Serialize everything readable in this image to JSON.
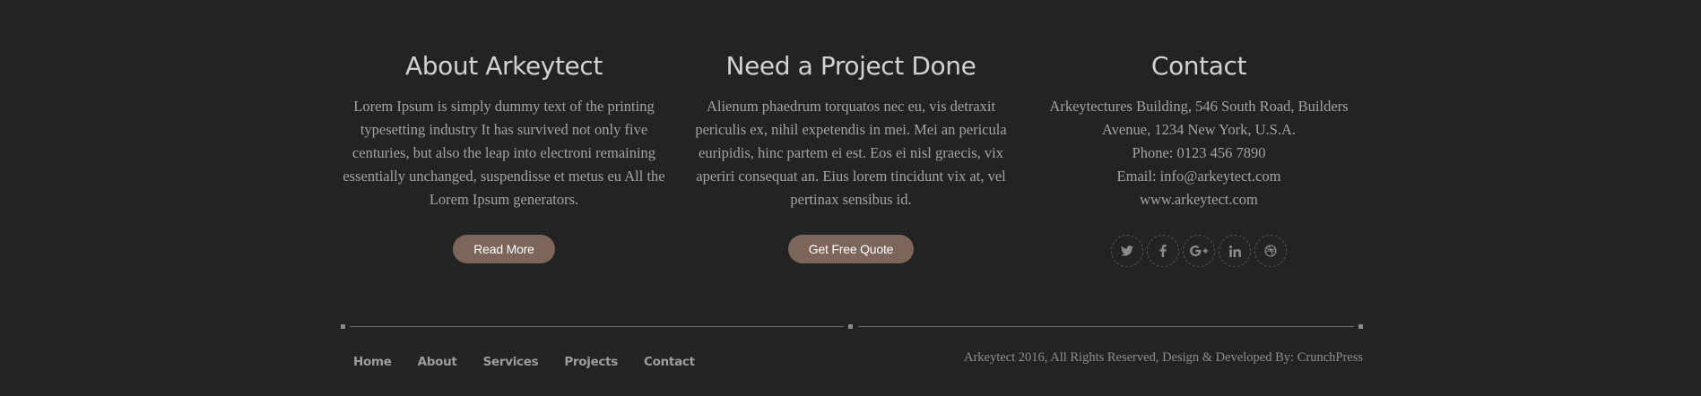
{
  "about": {
    "title": "About Arkeytect",
    "text": "Lorem Ipsum is simply dummy text of the printing typesetting industry It has survived not only five centuries, but also the leap into electroni remaining essentially unchanged, suspendisse et metus eu All the Lorem Ipsum generators.",
    "button_label": "Read More"
  },
  "project": {
    "title": "Need a Project Done",
    "text": "Alienum phaedrum torquatos nec eu, vis detraxit periculis ex, nihil expetendis in mei. Mei an pericula euripidis, hinc partem ei est. Eos ei nisl graecis, vix aperiri consequat an. Eius lorem tincidunt vix at, vel pertinax sensibus id.",
    "button_label": "Get Free Quote"
  },
  "contact": {
    "title": "Contact",
    "address_line1": "Arkeytectures Building, 546 South Road, Builders",
    "address_line2": "Avenue, 1234 New York, U.S.A.",
    "phone": "Phone: 0123 456 7890",
    "email": "Email: info@arkeytect.com",
    "website": "www.arkeytect.com",
    "social": [
      {
        "icon": "twitter-icon"
      },
      {
        "icon": "facebook-icon"
      },
      {
        "icon": "google-plus-icon"
      },
      {
        "icon": "linkedin-icon"
      },
      {
        "icon": "dribbble-icon"
      }
    ]
  },
  "footer": {
    "nav": {
      "home": "Home",
      "about": "About",
      "services": "Services",
      "projects": "Projects",
      "contact": "Contact"
    },
    "copyright": "Arkeytect 2016, All Rights Reserved, Design & Developed By: CrunchPress"
  },
  "colors": {
    "background": "#232323",
    "button": "#7d655a",
    "heading": "#d2d2d2",
    "body_text": "#a3a3a3"
  }
}
